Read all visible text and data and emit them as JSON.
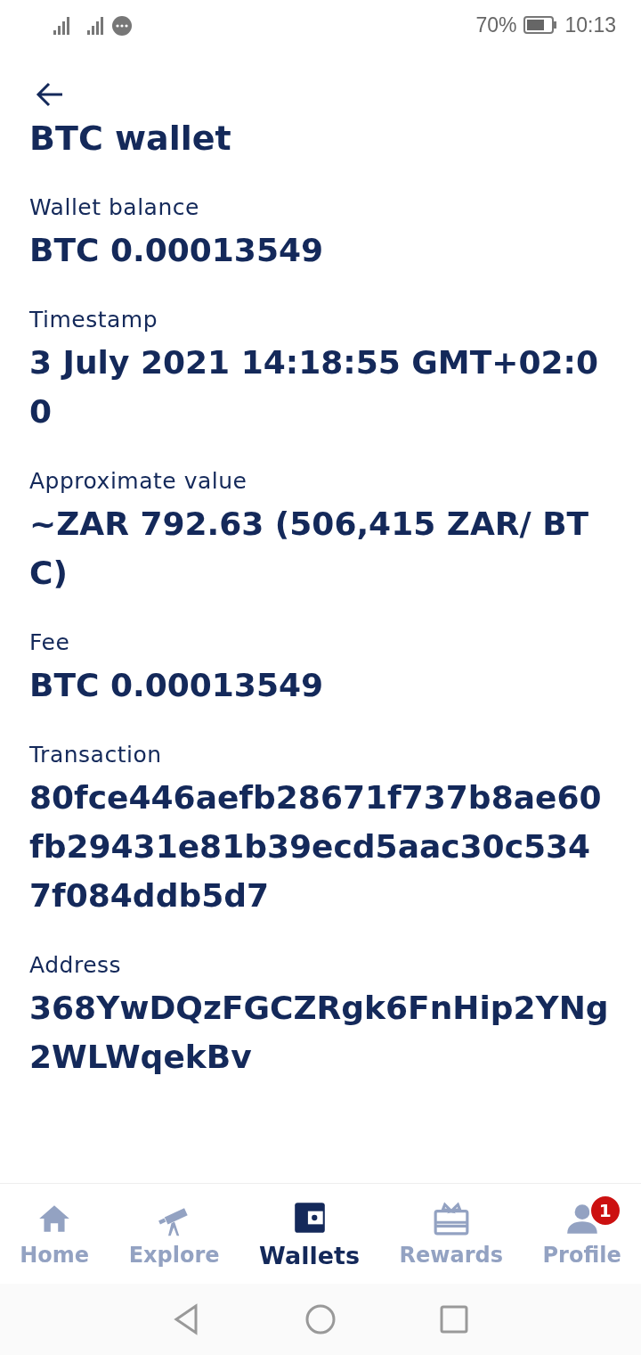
{
  "status_bar": {
    "battery_percent": "70%",
    "time": "10:13"
  },
  "title": "BTC wallet",
  "fields": [
    {
      "label": "Wallet balance",
      "value": "BTC 0.00013549"
    },
    {
      "label": "Timestamp",
      "value": "3 July 2021 14:18:55 GMT+02:00"
    },
    {
      "label": "Approximate value",
      "value": "~ZAR 792.63 (506,415 ZAR/ BTC)"
    },
    {
      "label": "Fee",
      "value": "BTC 0.00013549"
    },
    {
      "label": "Transaction",
      "value": "80fce446aefb28671f737b8ae60fb29431e81b39ecd5aac30c5347f084ddb5d7"
    },
    {
      "label": "Address",
      "value": "368YwDQzFGCZRgk6FnHip2YNg2WLWqekBv"
    }
  ],
  "bottom_nav": [
    {
      "kind": "home",
      "label": "Home",
      "selected": false
    },
    {
      "kind": "explore",
      "label": "Explore",
      "selected": false
    },
    {
      "kind": "wallets",
      "label": "Wallets",
      "selected": true
    },
    {
      "kind": "rewards",
      "label": "Rewards",
      "selected": false
    },
    {
      "kind": "profile",
      "label": "Profile",
      "selected": false,
      "badge": "1"
    }
  ]
}
